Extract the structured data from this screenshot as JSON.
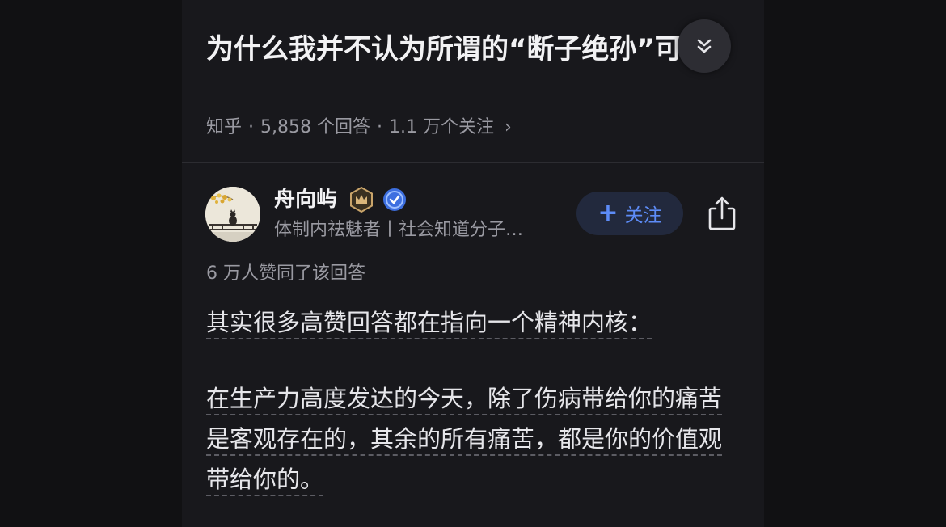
{
  "question": {
    "title": "为什么我并不认为所谓的“断子绝孙”可怕？",
    "source": "知乎",
    "answer_count": "5,858 个回答",
    "follow_count": "1.1 万个关注",
    "separator": "·",
    "chevron": "›"
  },
  "author": {
    "name": "舟向屿",
    "bio": "体制内祛魅者丨社会知道分子…",
    "follow_label": "关注",
    "follow_icon": "plus-icon",
    "badges": [
      "crown-badge-icon",
      "verified-badge-icon"
    ]
  },
  "answer": {
    "voteup_text": "6 万人赞同了该回答",
    "paragraphs": [
      "其实很多高赞回答都在指向一个精神内核：",
      "在生产力高度发达的今天，除了伤病带给你的痛苦是客观存在的，其余的所有痛苦，都是你的价值观带给你的。"
    ]
  },
  "colors": {
    "background": "#18181c",
    "accent": "#5d8cf7",
    "text_primary": "#f2f2f4",
    "text_secondary": "#9a9aa2"
  }
}
